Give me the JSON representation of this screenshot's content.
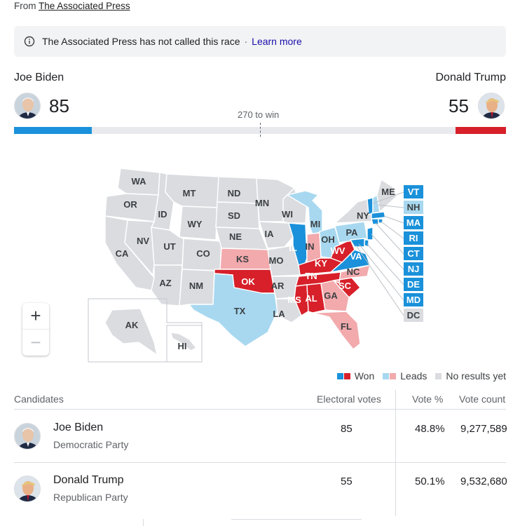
{
  "source": {
    "prefix": "From",
    "link": "The Associated Press"
  },
  "notice": {
    "text": "The Associated Press has not called this race",
    "separator": "·",
    "link": "Learn more"
  },
  "header": {
    "left": {
      "name": "Joe Biden",
      "votes": "85",
      "color": "#1a91da"
    },
    "right": {
      "name": "Donald Trump",
      "votes": "55",
      "color": "#d7202a"
    },
    "threshold_label": "270 to win",
    "progress": {
      "dem_votes": 85,
      "rep_votes": 55,
      "total": 538
    }
  },
  "map": {
    "states": {
      "WA": "WA",
      "OR": "OR",
      "CA": "CA",
      "ID": "ID",
      "NV": "NV",
      "MT": "MT",
      "WY": "WY",
      "UT": "UT",
      "AZ": "AZ",
      "CO": "CO",
      "NM": "NM",
      "ND": "ND",
      "SD": "SD",
      "NE": "NE",
      "KS": "KS",
      "OK": "OK",
      "TX": "TX",
      "MN": "MN",
      "IA": "IA",
      "MO": "MO",
      "AR": "AR",
      "LA": "LA",
      "WI": "WI",
      "IL": "IL",
      "MI": "MI",
      "IN": "IN",
      "OH": "OH",
      "KY": "KY",
      "TN": "TN",
      "MS": "MS",
      "AL": "AL",
      "GA": "GA",
      "FL": "FL",
      "SC": "SC",
      "NC": "NC",
      "VA": "VA",
      "WV": "WV",
      "PA": "PA",
      "NY": "NY",
      "ME": "ME",
      "AK": "AK",
      "HI": "HI"
    },
    "small_states": [
      "VT",
      "NH",
      "MA",
      "RI",
      "CT",
      "NJ",
      "DE",
      "MD",
      "DC"
    ]
  },
  "zoom": {
    "in": "+",
    "out": "−"
  },
  "legend": {
    "won": "Won",
    "leads": "Leads",
    "none": "No results yet"
  },
  "colors": {
    "dem_won": "#1a91da",
    "dem_leads": "#a8d8f0",
    "rep_won": "#d7202a",
    "rep_leads": "#f2aaad",
    "none": "#dadce0"
  },
  "table": {
    "headers": {
      "candidates": "Candidates",
      "electoral": "Electoral votes",
      "pct": "Vote %",
      "count": "Vote count"
    },
    "rows": [
      {
        "name": "Joe Biden",
        "party": "Democratic Party",
        "electoral": "85",
        "pct": "48.8%",
        "count": "9,277,589"
      },
      {
        "name": "Donald Trump",
        "party": "Republican Party",
        "electoral": "55",
        "pct": "50.1%",
        "count": "9,532,680"
      }
    ]
  }
}
